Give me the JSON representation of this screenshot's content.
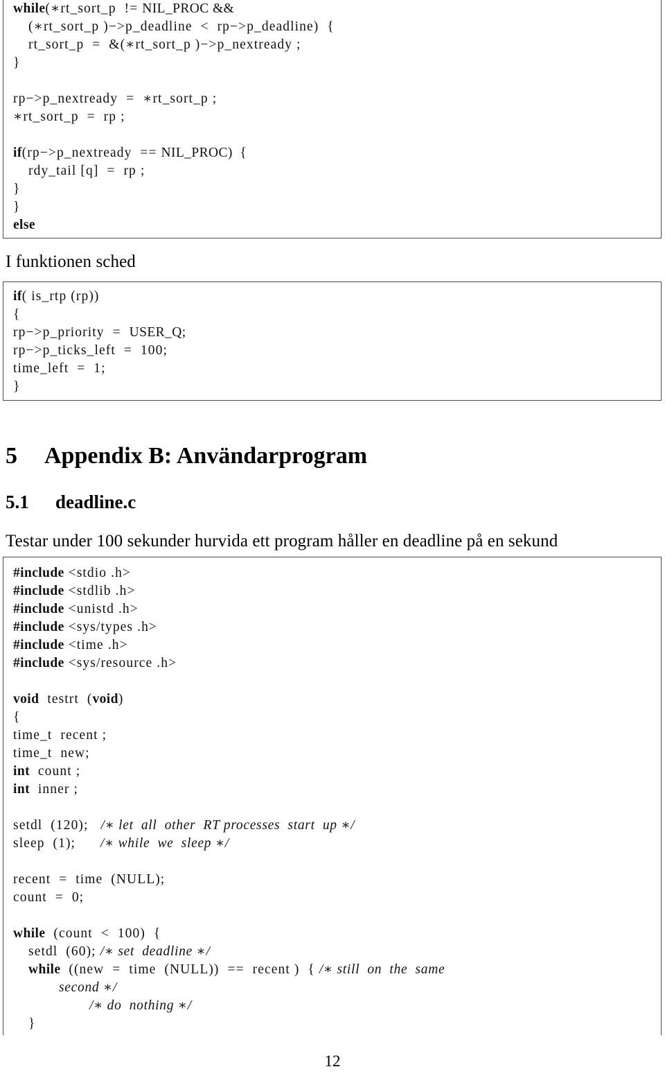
{
  "document": {
    "page_number": "12",
    "language": "sv"
  },
  "listing_1": {
    "name": "sched-insert-listing",
    "lines": [
      {
        "indent": 0,
        "parts": [
          {
            "t": "kw",
            "s": "while"
          },
          {
            "t": "id",
            "s": "(∗rt_sort_p  != "
          },
          {
            "t": "plain",
            "s": "NIL_PROC &&"
          }
        ]
      },
      {
        "indent": 1,
        "parts": [
          {
            "t": "id",
            "s": "(∗rt_sort_p )−>p_deadline  <  rp−>p_deadline)  {"
          }
        ]
      },
      {
        "indent": 1,
        "parts": [
          {
            "t": "id",
            "s": "rt_sort_p  =  &(∗rt_sort_p )−>p_nextready ;"
          }
        ]
      },
      {
        "indent": 0,
        "parts": [
          {
            "t": "id",
            "s": "}"
          }
        ]
      },
      {
        "indent": 0,
        "parts": [
          {
            "t": "id",
            "s": ""
          }
        ]
      },
      {
        "indent": 0,
        "parts": [
          {
            "t": "id",
            "s": "rp−>p_nextready  =  ∗rt_sort_p ;"
          }
        ]
      },
      {
        "indent": 0,
        "parts": [
          {
            "t": "id",
            "s": "∗rt_sort_p  =  rp ;"
          }
        ]
      },
      {
        "indent": 0,
        "parts": [
          {
            "t": "id",
            "s": ""
          }
        ]
      },
      {
        "indent": 0,
        "parts": [
          {
            "t": "kw",
            "s": "if"
          },
          {
            "t": "id",
            "s": "(rp−>p_nextready  == "
          },
          {
            "t": "plain",
            "s": "NIL_PROC)  {"
          }
        ]
      },
      {
        "indent": 1,
        "parts": [
          {
            "t": "id",
            "s": "rdy_tail [q]  =  rp ;"
          }
        ]
      },
      {
        "indent": 0,
        "parts": [
          {
            "t": "id",
            "s": "}"
          }
        ]
      },
      {
        "indent": -1,
        "parts": [
          {
            "t": "id",
            "s": "}"
          }
        ]
      },
      {
        "indent": -1,
        "parts": [
          {
            "t": "kw",
            "s": "else"
          }
        ]
      }
    ]
  },
  "paragraph_1": {
    "text": "I funktionen sched"
  },
  "listing_2": {
    "name": "sched-rtp-listing",
    "lines": [
      {
        "indent": -1,
        "parts": [
          {
            "t": "kw",
            "s": "if"
          },
          {
            "t": "id",
            "s": "( is_rtp (rp))"
          }
        ]
      },
      {
        "indent": -1,
        "parts": [
          {
            "t": "id",
            "s": "{"
          }
        ]
      },
      {
        "indent": 0,
        "parts": [
          {
            "t": "id",
            "s": "rp−>p_priority  =  "
          },
          {
            "t": "plain",
            "s": "USER_Q;"
          }
        ]
      },
      {
        "indent": 0,
        "parts": [
          {
            "t": "id",
            "s": "rp−>p_ticks_left  =  100;"
          }
        ]
      },
      {
        "indent": 0,
        "parts": [
          {
            "t": "id",
            "s": "time_left  =  1;"
          }
        ]
      },
      {
        "indent": -1,
        "parts": [
          {
            "t": "id",
            "s": "}"
          }
        ]
      }
    ]
  },
  "heading_section": {
    "number": "5",
    "title": "Appendix B: Användarprogram"
  },
  "heading_subsection": {
    "number": "5.1",
    "title": "deadline.c"
  },
  "paragraph_2": {
    "text": "Testar under 100 sekunder hurvida ett program håller en deadline på en sekund"
  },
  "listing_3": {
    "name": "deadline-c-listing",
    "lines": [
      {
        "indent": -1,
        "parts": [
          {
            "t": "kw",
            "s": "#include"
          },
          {
            "t": "id",
            "s": " <stdio .h>"
          }
        ]
      },
      {
        "indent": -1,
        "parts": [
          {
            "t": "kw",
            "s": "#include"
          },
          {
            "t": "id",
            "s": " <stdlib .h>"
          }
        ]
      },
      {
        "indent": -1,
        "parts": [
          {
            "t": "kw",
            "s": "#include"
          },
          {
            "t": "id",
            "s": " <unistd .h>"
          }
        ]
      },
      {
        "indent": -1,
        "parts": [
          {
            "t": "kw",
            "s": "#include"
          },
          {
            "t": "id",
            "s": " <sys/types .h>"
          }
        ]
      },
      {
        "indent": -1,
        "parts": [
          {
            "t": "kw",
            "s": "#include"
          },
          {
            "t": "id",
            "s": " <time .h>"
          }
        ]
      },
      {
        "indent": -1,
        "parts": [
          {
            "t": "kw",
            "s": "#include"
          },
          {
            "t": "id",
            "s": " <sys/resource .h>"
          }
        ]
      },
      {
        "indent": -1,
        "parts": [
          {
            "t": "id",
            "s": ""
          }
        ]
      },
      {
        "indent": -1,
        "parts": [
          {
            "t": "kw",
            "s": "void"
          },
          {
            "t": "id",
            "s": "  testrt  ("
          },
          {
            "t": "kw",
            "s": "void"
          },
          {
            "t": "id",
            "s": ")"
          }
        ]
      },
      {
        "indent": -1,
        "parts": [
          {
            "t": "id",
            "s": "{"
          }
        ]
      },
      {
        "indent": 0,
        "parts": [
          {
            "t": "id",
            "s": "time_t  recent ;"
          }
        ]
      },
      {
        "indent": 0,
        "parts": [
          {
            "t": "id",
            "s": "time_t  new;"
          }
        ]
      },
      {
        "indent": 0,
        "parts": [
          {
            "t": "kw",
            "s": "int"
          },
          {
            "t": "id",
            "s": "  count ;"
          }
        ]
      },
      {
        "indent": 0,
        "parts": [
          {
            "t": "kw",
            "s": "int"
          },
          {
            "t": "id",
            "s": "  inner ;"
          }
        ]
      },
      {
        "indent": 0,
        "parts": [
          {
            "t": "id",
            "s": ""
          }
        ]
      },
      {
        "indent": 0,
        "parts": [
          {
            "t": "id",
            "s": "setdl  (120);   "
          },
          {
            "t": "cmt",
            "s": "/∗ let  all  other  RT processes  start  up ∗/"
          }
        ]
      },
      {
        "indent": 0,
        "parts": [
          {
            "t": "id",
            "s": "sleep  (1);      "
          },
          {
            "t": "cmt",
            "s": "/∗ while  we  sleep ∗/"
          }
        ]
      },
      {
        "indent": 0,
        "parts": [
          {
            "t": "id",
            "s": ""
          }
        ]
      },
      {
        "indent": 0,
        "parts": [
          {
            "t": "id",
            "s": "recent  =  time  (NULL);"
          }
        ]
      },
      {
        "indent": 0,
        "parts": [
          {
            "t": "id",
            "s": "count  =  0;"
          }
        ]
      },
      {
        "indent": 0,
        "parts": [
          {
            "t": "id",
            "s": ""
          }
        ]
      },
      {
        "indent": 0,
        "parts": [
          {
            "t": "kw",
            "s": "while"
          },
          {
            "t": "id",
            "s": "  (count  <  100)  {"
          }
        ]
      },
      {
        "indent": 1,
        "parts": [
          {
            "t": "id",
            "s": "setdl  (60); "
          },
          {
            "t": "cmt",
            "s": "/∗ set  deadline ∗/"
          }
        ]
      },
      {
        "indent": 1,
        "parts": [
          {
            "t": "kw",
            "s": "while"
          },
          {
            "t": "id",
            "s": "  ((new  =  time  (NULL))  ==  recent )  { "
          },
          {
            "t": "cmt",
            "s": "/∗ still  on  the  same"
          }
        ]
      },
      {
        "indent": 3,
        "parts": [
          {
            "t": "cmt",
            "s": "second ∗/"
          }
        ]
      },
      {
        "indent": 5,
        "parts": [
          {
            "t": "cmt",
            "s": "/∗ do  nothing ∗/"
          }
        ]
      },
      {
        "indent": 1,
        "parts": [
          {
            "t": "id",
            "s": "}"
          }
        ]
      }
    ]
  }
}
